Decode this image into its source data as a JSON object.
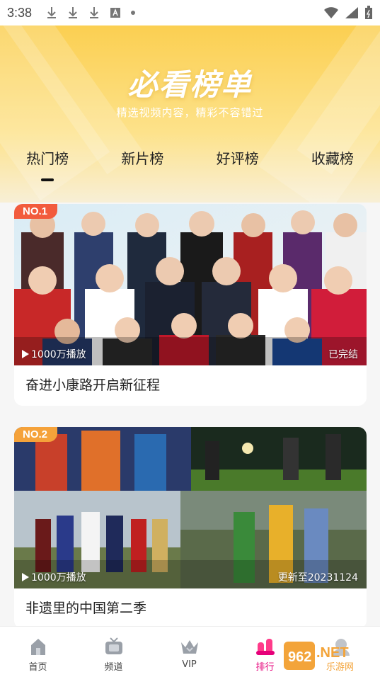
{
  "status_bar": {
    "time": "3:38"
  },
  "header": {
    "title": "必看榜单",
    "subtitle": "精选视频内容，精彩不容错过"
  },
  "tabs": [
    {
      "label": "热门榜",
      "active": true
    },
    {
      "label": "新片榜",
      "active": false
    },
    {
      "label": "好评榜",
      "active": false
    },
    {
      "label": "收藏榜",
      "active": false
    }
  ],
  "cards": [
    {
      "rank": "NO.1",
      "badge_color": "#f25b3d",
      "play_count": "1000万播放",
      "status": "已完结",
      "title": "奋进小康路开启新征程"
    },
    {
      "rank": "NO.2",
      "badge_color": "#f5a23a",
      "play_count": "1000万播放",
      "status": "更新至20231124",
      "title": "非遗里的中国第二季"
    }
  ],
  "bottom_nav": [
    {
      "label": "首页",
      "icon": "home-icon"
    },
    {
      "label": "频道",
      "icon": "tv-icon"
    },
    {
      "label": "VIP",
      "icon": "crown-icon"
    },
    {
      "label": "排行",
      "icon": "ranking-icon",
      "active": true
    }
  ],
  "watermark": {
    "text": "962.NET",
    "subtext": "乐游网"
  }
}
